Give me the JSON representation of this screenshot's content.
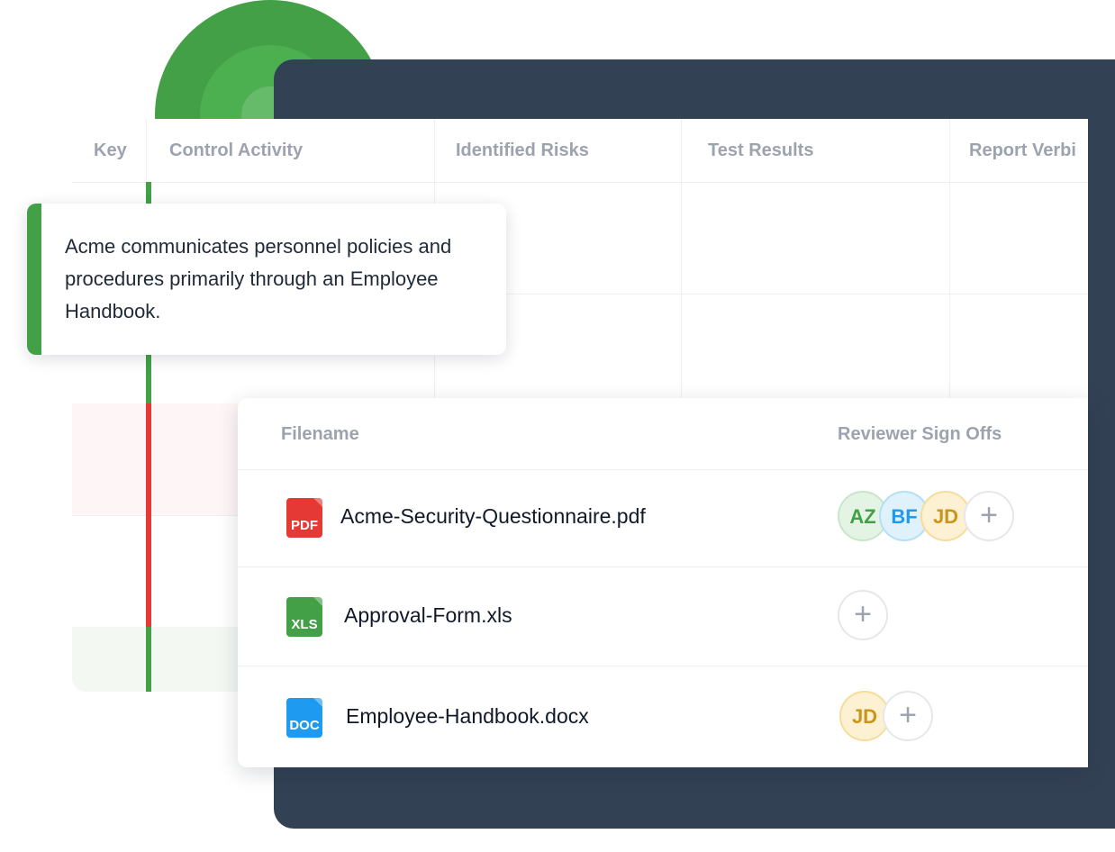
{
  "colors": {
    "accent_green": "#43a047",
    "accent_red": "#e53935",
    "dark_frame": "#334155",
    "pdf": "#e53935",
    "xls": "#43a047",
    "doc": "#1e9bf0"
  },
  "controls_table": {
    "columns": [
      "Key",
      "Control Activity",
      "Identified Risks",
      "Test Results",
      "Report Verbi"
    ]
  },
  "tooltip": {
    "text": "Acme communicates personnel policies and procedures primarily through an Employee Handbook."
  },
  "files_table": {
    "columns": {
      "filename": "Filename",
      "reviewer_sign_offs": "Reviewer Sign Offs"
    },
    "files": [
      {
        "icon": "pdf-file-icon",
        "type_label": "PDF",
        "name": "Acme-Security-Questionnaire.pdf",
        "reviewers": [
          {
            "initials": "AZ",
            "bg": "#e3f4e4",
            "border": "#c8e6c9",
            "color": "#43a047"
          },
          {
            "initials": "BF",
            "bg": "#dff2fb",
            "border": "#b3e0f5",
            "color": "#1e9bf0"
          },
          {
            "initials": "JD",
            "bg": "#fdf1d4",
            "border": "#f7dc9c",
            "color": "#c9961a"
          }
        ],
        "add_label": "+"
      },
      {
        "icon": "xls-file-icon",
        "type_label": "XLS",
        "name": "Approval-Form.xls",
        "reviewers": [],
        "add_label": "+"
      },
      {
        "icon": "doc-file-icon",
        "type_label": "DOC",
        "name": "Employee-Handbook.docx",
        "reviewers": [
          {
            "initials": "JD",
            "bg": "#fdf1d4",
            "border": "#f7dc9c",
            "color": "#c9961a"
          }
        ],
        "add_label": "+"
      }
    ]
  }
}
